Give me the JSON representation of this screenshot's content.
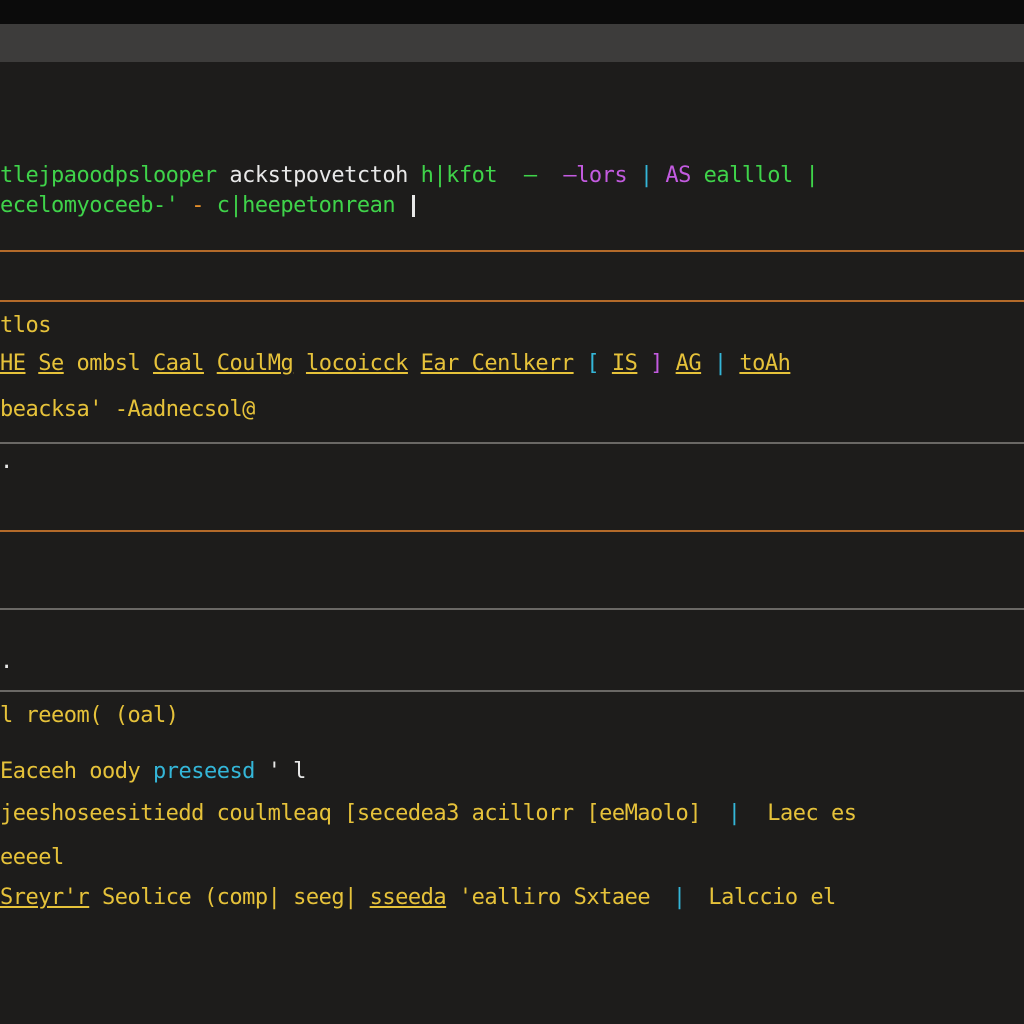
{
  "colors": {
    "background": "#1b1a19",
    "titlebar": "#3d3c3b",
    "orange_rule": "#b36a2a",
    "grey_rule": "#6a6865",
    "green": "#3fd34a",
    "yellow": "#e6c23a",
    "orange": "#e8902a",
    "cyan": "#34b6d8",
    "magenta": "#c35be0",
    "white": "#e8e8e8"
  },
  "block1": {
    "line1": {
      "seg1": "tlejpaoodpslooper",
      "seg2": "ackstpovetctoh",
      "seg3": "h|kfot",
      "seg4": "—",
      "seg5": "–lors",
      "seg6": "|",
      "seg7": "AS",
      "seg8": "ealllol",
      "seg9": "|"
    },
    "line2": {
      "seg1": "ecelomyoceeb-'",
      "seg2": "-",
      "seg3": "c|heepetonrean"
    }
  },
  "block2": {
    "line1": {
      "text": "tlos"
    },
    "line2": {
      "seg1": "HE",
      "seg2": "Se",
      "seg3": "ombsl",
      "seg4": "Caal",
      "seg5": "CoulMg",
      "seg6": "locoicck",
      "seg7": "Ear Cenlkerr",
      "seg8": "[",
      "seg9": "IS",
      "seg10": "]",
      "seg11": "AG",
      "seg12": "|",
      "seg13": "toAh"
    },
    "line3": {
      "seg1": "beacksa'",
      "seg2": "-Aadnecsol@"
    }
  },
  "block3": {
    "line1": {
      "text": "."
    }
  },
  "block4": {
    "line1": {
      "seg1": "l reeom(",
      "seg2": "(oal)"
    },
    "line2": {
      "seg1": "Eaceeh",
      "seg2": "oody",
      "seg3": "preseesd",
      "seg4": "' l"
    },
    "line3": {
      "seg1": "jeeshoseesitiedd",
      "seg2": "coulmleaq",
      "seg3": "[secedea3",
      "seg4": "acillorr",
      "seg5": "[eeMaolo]",
      "seg6": "|",
      "seg7": "Laec es"
    },
    "line4": {
      "seg1": "eeeel"
    },
    "line5": {
      "seg1": "Sreyr'r",
      "seg2": "Seolice",
      "seg3": "(comp|",
      "seg4": "seeg|",
      "seg5": "sseeda",
      "seg6": "'ealliro",
      "seg7": "Sxtaee",
      "seg8": "|",
      "seg9": "Lalccio",
      "seg10": "el"
    }
  }
}
